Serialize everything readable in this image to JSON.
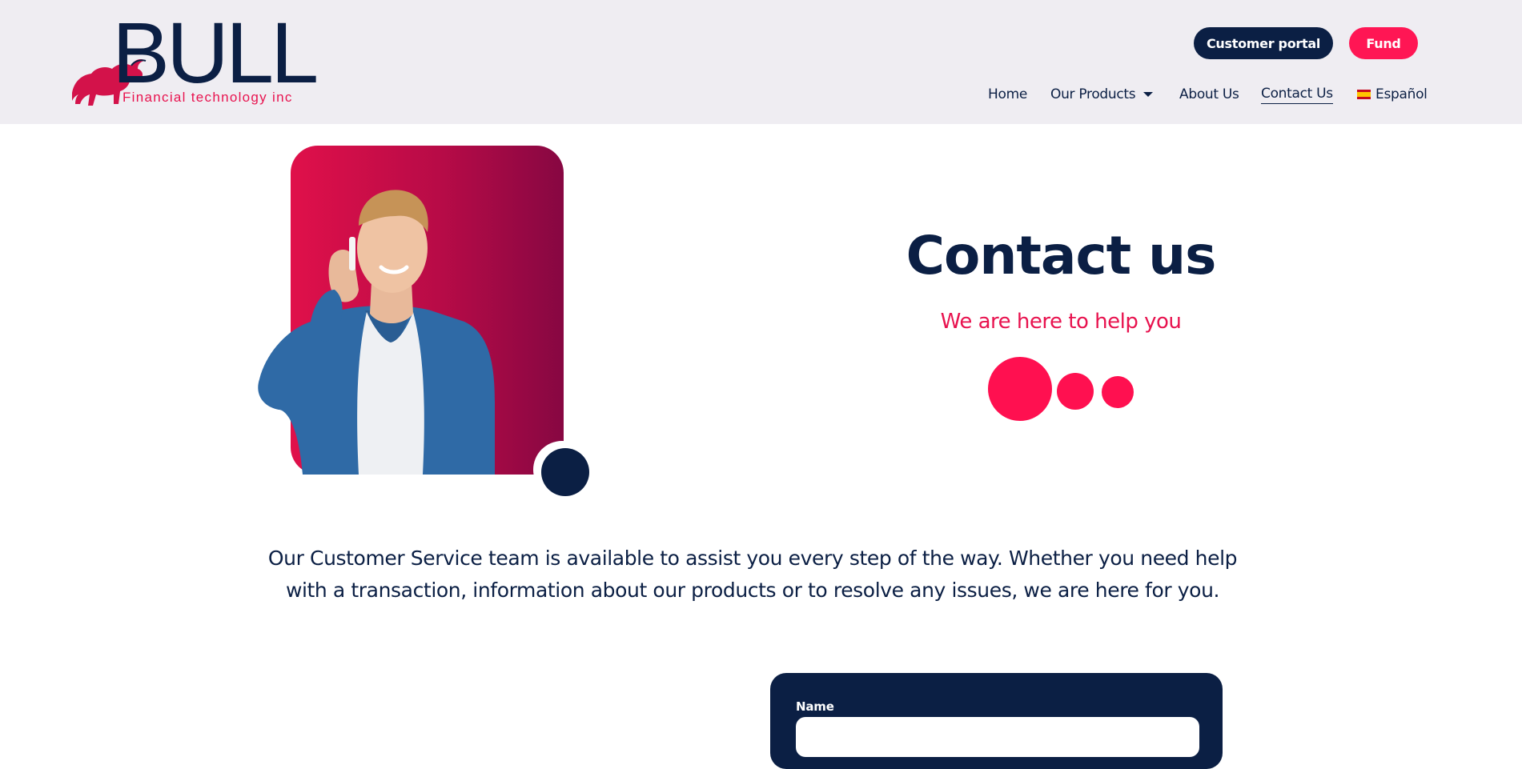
{
  "header": {
    "logo": {
      "word": "BULL",
      "tagline": "Financial technology inc"
    },
    "buttons": {
      "portal": "Customer portal",
      "fund": "Fund"
    },
    "nav": {
      "home": "Home",
      "products": "Our Products",
      "about": "About Us",
      "contact": "Contact Us",
      "language": "Español"
    }
  },
  "hero": {
    "title": "Contact us",
    "subtitle": "We are here to help you"
  },
  "intro": {
    "text": "Our Customer Service team is available to assist you every step of the way. Whether you need help with a transaction, information about our products or to resolve any issues, we are here for you."
  },
  "form": {
    "name_label": "Name",
    "name_value": ""
  },
  "colors": {
    "navy": "#0b1f44",
    "accent": "#ff1654",
    "header_bg": "#efedf2"
  },
  "icons": [
    "bull-logo-icon",
    "spain-flag-icon",
    "chevron-down-icon"
  ]
}
